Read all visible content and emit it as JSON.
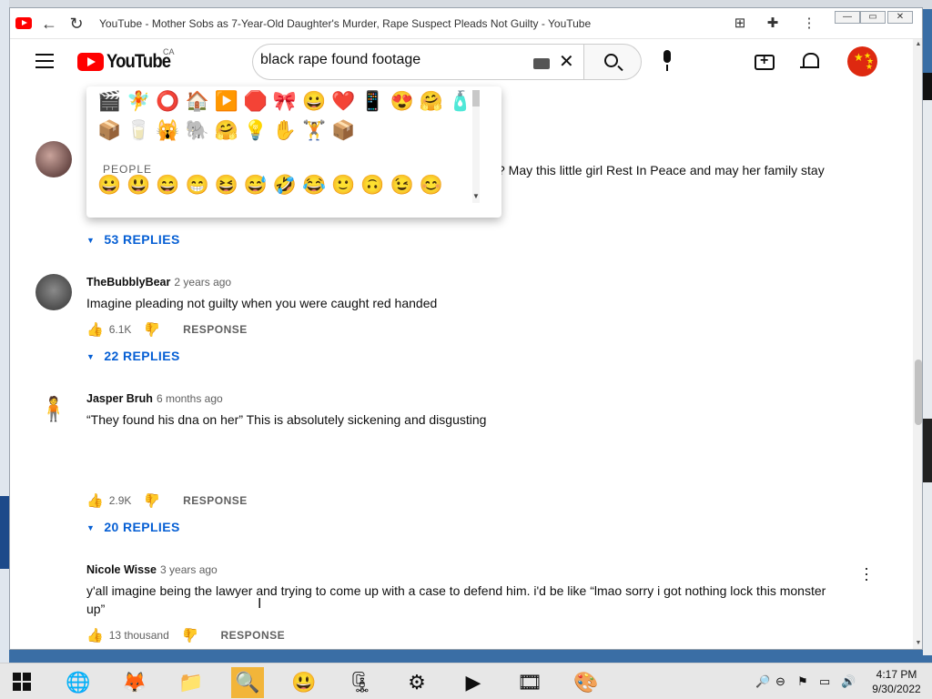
{
  "browser": {
    "tab_title": "YouTube - Mother Sobs as 7-Year-Old Daughter's Murder, Rape Suspect Pleads Not Guilty - YouTube"
  },
  "header": {
    "logo_text": "YouTube",
    "region": "CA",
    "search_value": "black rape found footage"
  },
  "emoji_picker": {
    "row1": "🎬🧚⭕🏠▶️🛑🎀😀❤️📱😍🤗🧴",
    "row2": "📦🥛🙀🐘🤗💡✋🏋️📦",
    "section_label": "PEOPLE",
    "row3": "😀😃😄😁😆😅🤣😂🙂🙃😉😊"
  },
  "comments": [
    {
      "partial_text": "? May this little girl Rest In Peace and may her family stay",
      "replies": "53 REPLIES"
    },
    {
      "author": "TheBubblyBear",
      "time": "2 years ago",
      "text": "Imagine pleading not guilty when you were caught red handed",
      "likes": "6.1K",
      "response": "RESPONSE",
      "replies": "22 REPLIES"
    },
    {
      "author": "Jasper Bruh",
      "time": "6 months ago",
      "text": "“They found his dna on her” This is absolutely sickening and disgusting",
      "likes": "2.9K",
      "response": "RESPONSE",
      "replies": "20 REPLIES"
    },
    {
      "author": "Nicole Wisse",
      "time": "3 years ago",
      "text": "y'all imagine being the lawyer and trying to come up with a case to defend him. i'd be like “lmao sorry i got nothing lock this monster up”",
      "likes": "13 thousand",
      "response": "RESPONSE"
    }
  ],
  "taskbar": {
    "time": "4:17 PM",
    "date": "9/30/2022"
  }
}
